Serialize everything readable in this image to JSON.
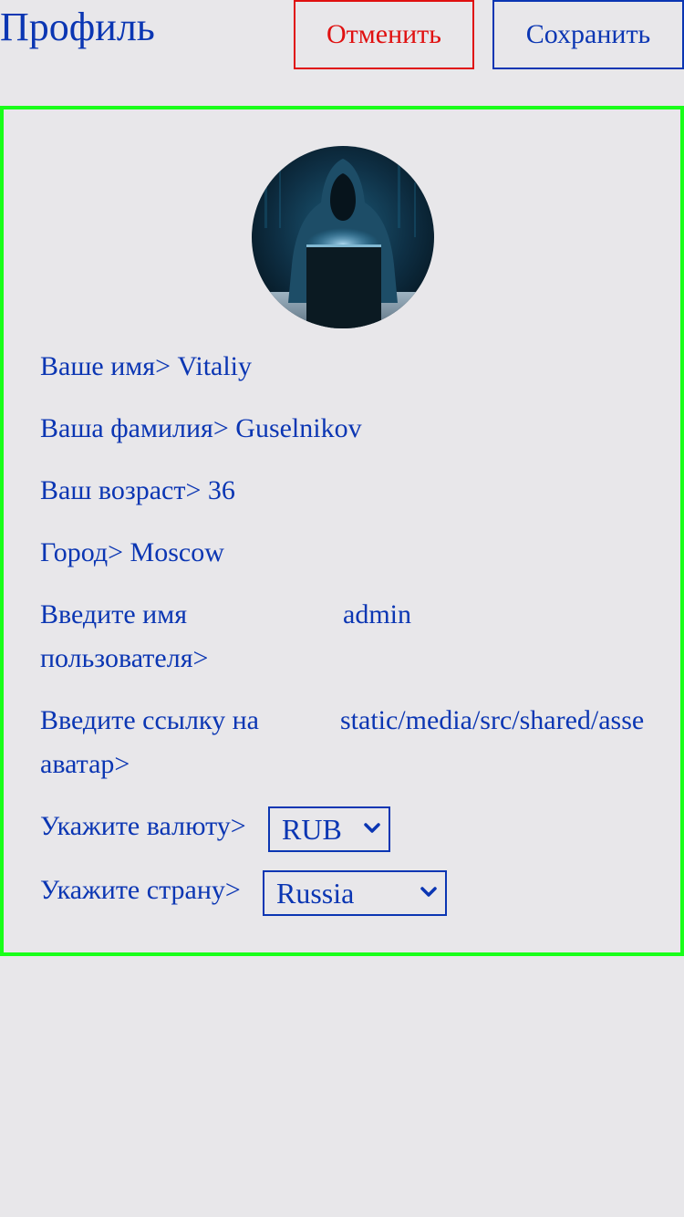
{
  "header": {
    "title": "Профиль",
    "cancel_label": "Отменить",
    "save_label": "Сохранить"
  },
  "colors": {
    "accent": "#0b36b3",
    "cancel": "#e01010",
    "card_border": "#19ff19",
    "background": "#e8e7ea"
  },
  "profile": {
    "avatar_icon": "hooded-hacker-avatar",
    "first_name_label": "Ваше имя>",
    "first_name_value": "Vitaliy",
    "last_name_label": "Ваша фамилия>",
    "last_name_value": "Guselnikov",
    "age_label": "Ваш возраст>",
    "age_value": "36",
    "city_label": "Город>",
    "city_value": "Moscow",
    "username_label_line1": "Введите имя",
    "username_label_line2": "пользователя>",
    "username_value": "admin",
    "avatar_url_label_line1": "Введите ссылку на",
    "avatar_url_label_line2": "аватар>",
    "avatar_url_value": "static/media/src/shared/assets",
    "currency_label": "Укажите валюту>",
    "currency_value": "RUB",
    "country_label": "Укажите страну>",
    "country_value": "Russia"
  }
}
